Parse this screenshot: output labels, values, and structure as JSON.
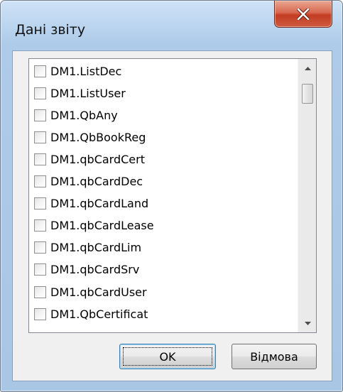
{
  "window": {
    "title": "Дані звіту",
    "close_icon": "close-x-icon"
  },
  "list": {
    "items": [
      {
        "label": "DM1.ListDec",
        "checked": false
      },
      {
        "label": "DM1.ListUser",
        "checked": false
      },
      {
        "label": "DM1.QbAny",
        "checked": false
      },
      {
        "label": "DM1.QbBookReg",
        "checked": false
      },
      {
        "label": "DM1.qbCardCert",
        "checked": false
      },
      {
        "label": "DM1.qbCardDec",
        "checked": false
      },
      {
        "label": "DM1.qbCardLand",
        "checked": false
      },
      {
        "label": "DM1.qbCardLease",
        "checked": false
      },
      {
        "label": "DM1.qbCardLim",
        "checked": false
      },
      {
        "label": "DM1.qbCardSrv",
        "checked": false
      },
      {
        "label": "DM1.qbCardUser",
        "checked": false
      },
      {
        "label": "DM1.QbCertificat",
        "checked": false
      }
    ]
  },
  "scrollbar": {
    "up_icon": "scroll-up-arrow-icon",
    "down_icon": "scroll-down-arrow-icon"
  },
  "buttons": {
    "ok_label": "OK",
    "cancel_label": "Відмова"
  },
  "colors": {
    "frame": "#aecbe9",
    "close_button": "#c8452b",
    "client_bg": "#f0f0f0",
    "focus_border": "#3c7fb1"
  }
}
